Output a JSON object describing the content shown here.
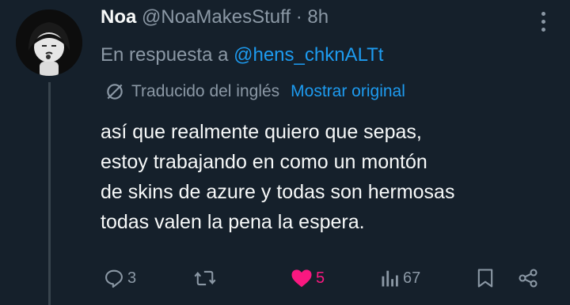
{
  "tweet": {
    "author_name": "Noa",
    "author_handle": "@NoaMakesStuff",
    "separator": "·",
    "time": "8h",
    "reply_prefix": "En respuesta a",
    "reply_to": "@hens_chknALTt",
    "translated_label": "Traducido del inglés",
    "show_original": "Mostrar original",
    "body_lines": [
      "así que realmente quiero que sepas,",
      "estoy trabajando en como un montón",
      "de skins de azure y todas son hermosas",
      "todas valen la pena la espera."
    ]
  },
  "actions": {
    "reply_count": "3",
    "like_count": "5",
    "views_count": "67"
  },
  "colors": {
    "background": "#15202b",
    "accent": "#1d9bf0",
    "like": "#f91880",
    "muted": "#8b98a5",
    "text": "#f7f9f9"
  },
  "icons": [
    "globe-slash-icon",
    "reply-icon",
    "retweet-icon",
    "heart-icon",
    "views-icon",
    "bookmark-icon",
    "share-icon",
    "more-icon"
  ]
}
